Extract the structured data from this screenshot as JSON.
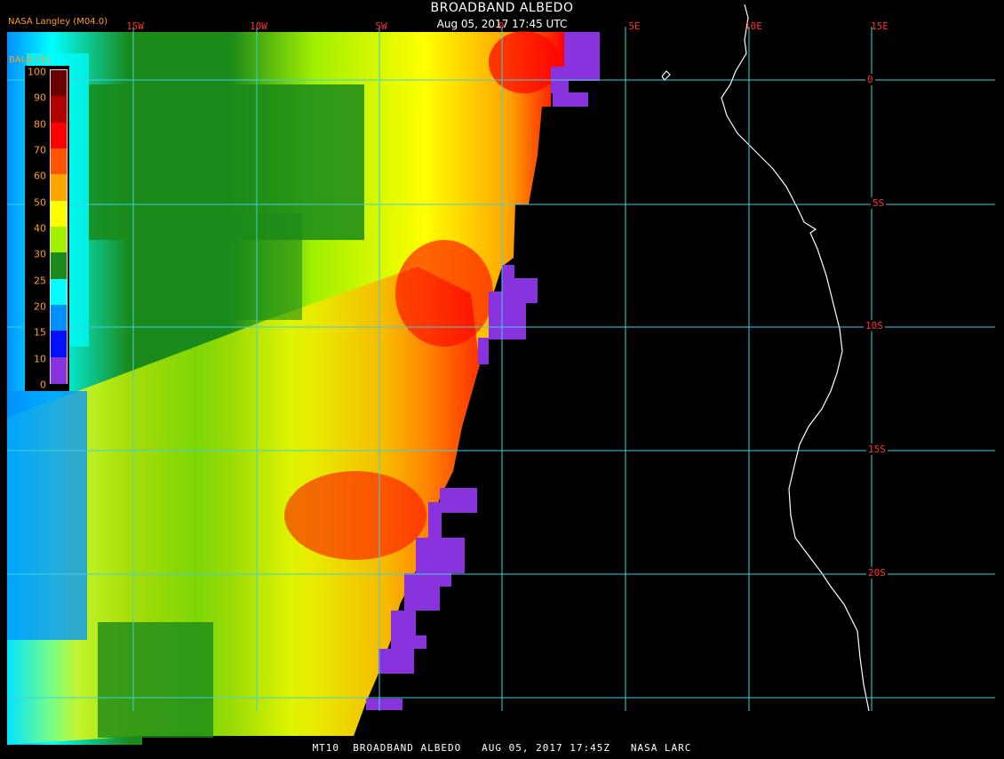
{
  "header": {
    "title": "BROADBAND ALBEDO",
    "subtitle": "Aug 05, 2017 17:45 UTC",
    "credit": "NASA Langley (M04.0)"
  },
  "footer": {
    "text": "MT10  BROADBAND ALBEDO   AUG 05, 2017 17:45Z   NASA LARC"
  },
  "map": {
    "longitude_labels": [
      "15W",
      "10W",
      "5W",
      "0",
      "5E",
      "10E",
      "15E"
    ],
    "latitude_labels": [
      "0",
      "5S",
      "10S",
      "15S",
      "20S"
    ],
    "colors": {
      "grid": "#40d0e0",
      "coastline": "#ffffff",
      "background": "#000000",
      "label": "#ff3030"
    }
  },
  "legend": {
    "title": "BALB (%)",
    "labels": [
      "100",
      "90",
      "80",
      "70",
      "60",
      "50",
      "40",
      "30",
      "25",
      "20",
      "15",
      "10",
      "0"
    ],
    "colors": [
      "#6a0000",
      "#b00000",
      "#ff0000",
      "#ff5500",
      "#ffa500",
      "#ffff00",
      "#a0f000",
      "#1a8a1a",
      "#00ffff",
      "#0090ff",
      "#0010ff",
      "#8833dd"
    ]
  }
}
